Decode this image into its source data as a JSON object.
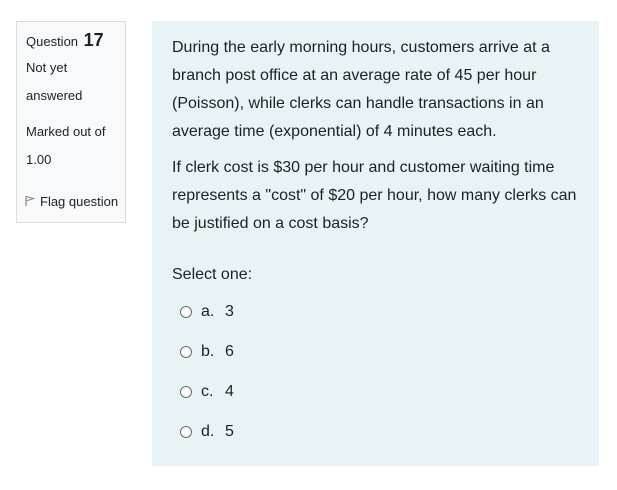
{
  "question_info": {
    "label": "Question",
    "number": "17",
    "state_line1": "Not yet",
    "state_line2": "answered",
    "grade_line1": "Marked out of",
    "grade_line2": "1.00",
    "flag_label": "Flag question",
    "flag_icon": "flag-icon"
  },
  "question": {
    "paragraphs": [
      "During the early morning hours, customers arrive at a branch post office at an average rate of 45 per hour (Poisson), while clerks can handle transactions in an average time (exponential) of 4 minutes each.",
      "If clerk cost is $30 per hour and customer waiting time represents a \"cost\" of $20 per hour, how many clerks can be justified on a cost basis?"
    ],
    "prompt": "Select one:",
    "options": [
      {
        "letter": "a.",
        "value": "3"
      },
      {
        "letter": "b.",
        "value": "6"
      },
      {
        "letter": "c.",
        "value": "4"
      },
      {
        "letter": "d.",
        "value": "5"
      }
    ]
  },
  "colors": {
    "content_bg": "#e7f3f5",
    "info_bg": "#f8f9fa",
    "text": "#1d2125"
  }
}
